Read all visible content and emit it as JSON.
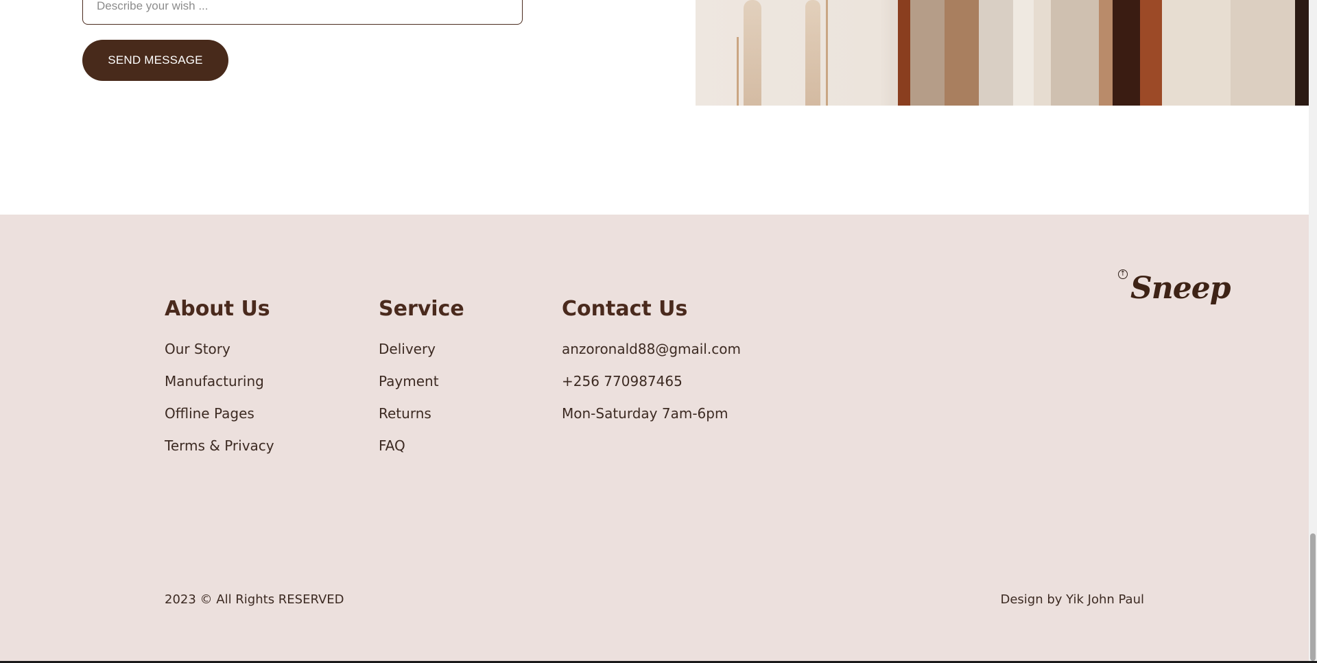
{
  "contact_form": {
    "wish_placeholder": "Describe your wish ...",
    "send_label": "SEND MESSAGE"
  },
  "footer": {
    "about": {
      "heading": "About Us",
      "links": [
        "Our Story",
        "Manufacturing",
        "Offline Pages",
        "Terms & Privacy"
      ]
    },
    "service": {
      "heading": "Service",
      "links": [
        "Delivery",
        "Payment",
        "Returns",
        "FAQ"
      ]
    },
    "contact": {
      "heading": "Contact Us",
      "items": [
        "anzoronald88@gmail.com",
        "+256 770987465",
        "Mon-Saturday 7am-6pm"
      ]
    },
    "logo": {
      "text": "Sneep",
      "icon": "arrow-up-circle-icon"
    },
    "copyright": "2023 © All Rights RESERVED",
    "credit": "Design by Yik John Paul"
  },
  "colors": {
    "brand_brown": "#482a1b",
    "footer_bg": "#ece0dd",
    "text": "#3c2a22"
  }
}
